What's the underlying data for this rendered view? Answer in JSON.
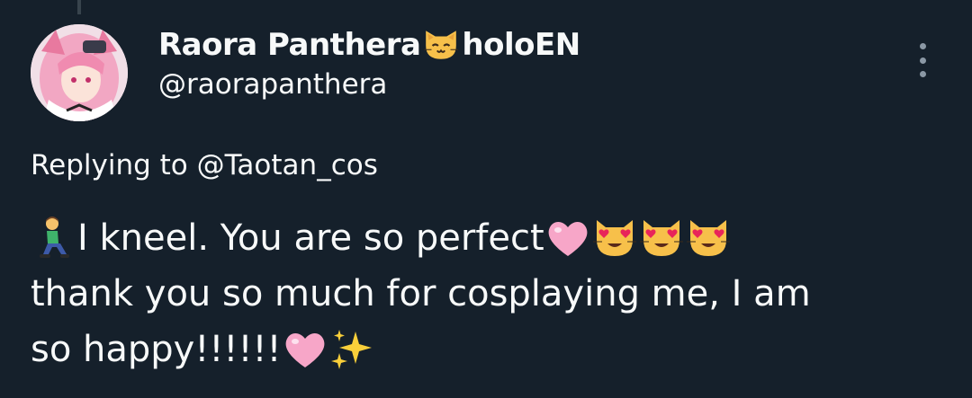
{
  "tweet": {
    "display_name_part1": "Raora Panthera",
    "display_name_part2": "holoEN",
    "name_emoji": "cat-face-icon",
    "handle": "@raorapanthera",
    "replying_to": "Replying to @Taotan_cos",
    "text_line1": "I kneel. You are so perfect",
    "text_line2": "thank you so much for cosplaying me, I am",
    "text_line3": "so happy!!!!!!",
    "text_line1_emojis": [
      "person-kneeling-icon",
      "pink-heart-icon",
      "heart-eyes-cat-icon",
      "heart-eyes-cat-icon",
      "heart-eyes-cat-icon"
    ],
    "text_line3_emojis": [
      "pink-heart-icon",
      "sparkles-icon"
    ]
  },
  "colors": {
    "background": "#15202b",
    "text": "#f7f9f9",
    "secondary": "#8b98a5"
  }
}
